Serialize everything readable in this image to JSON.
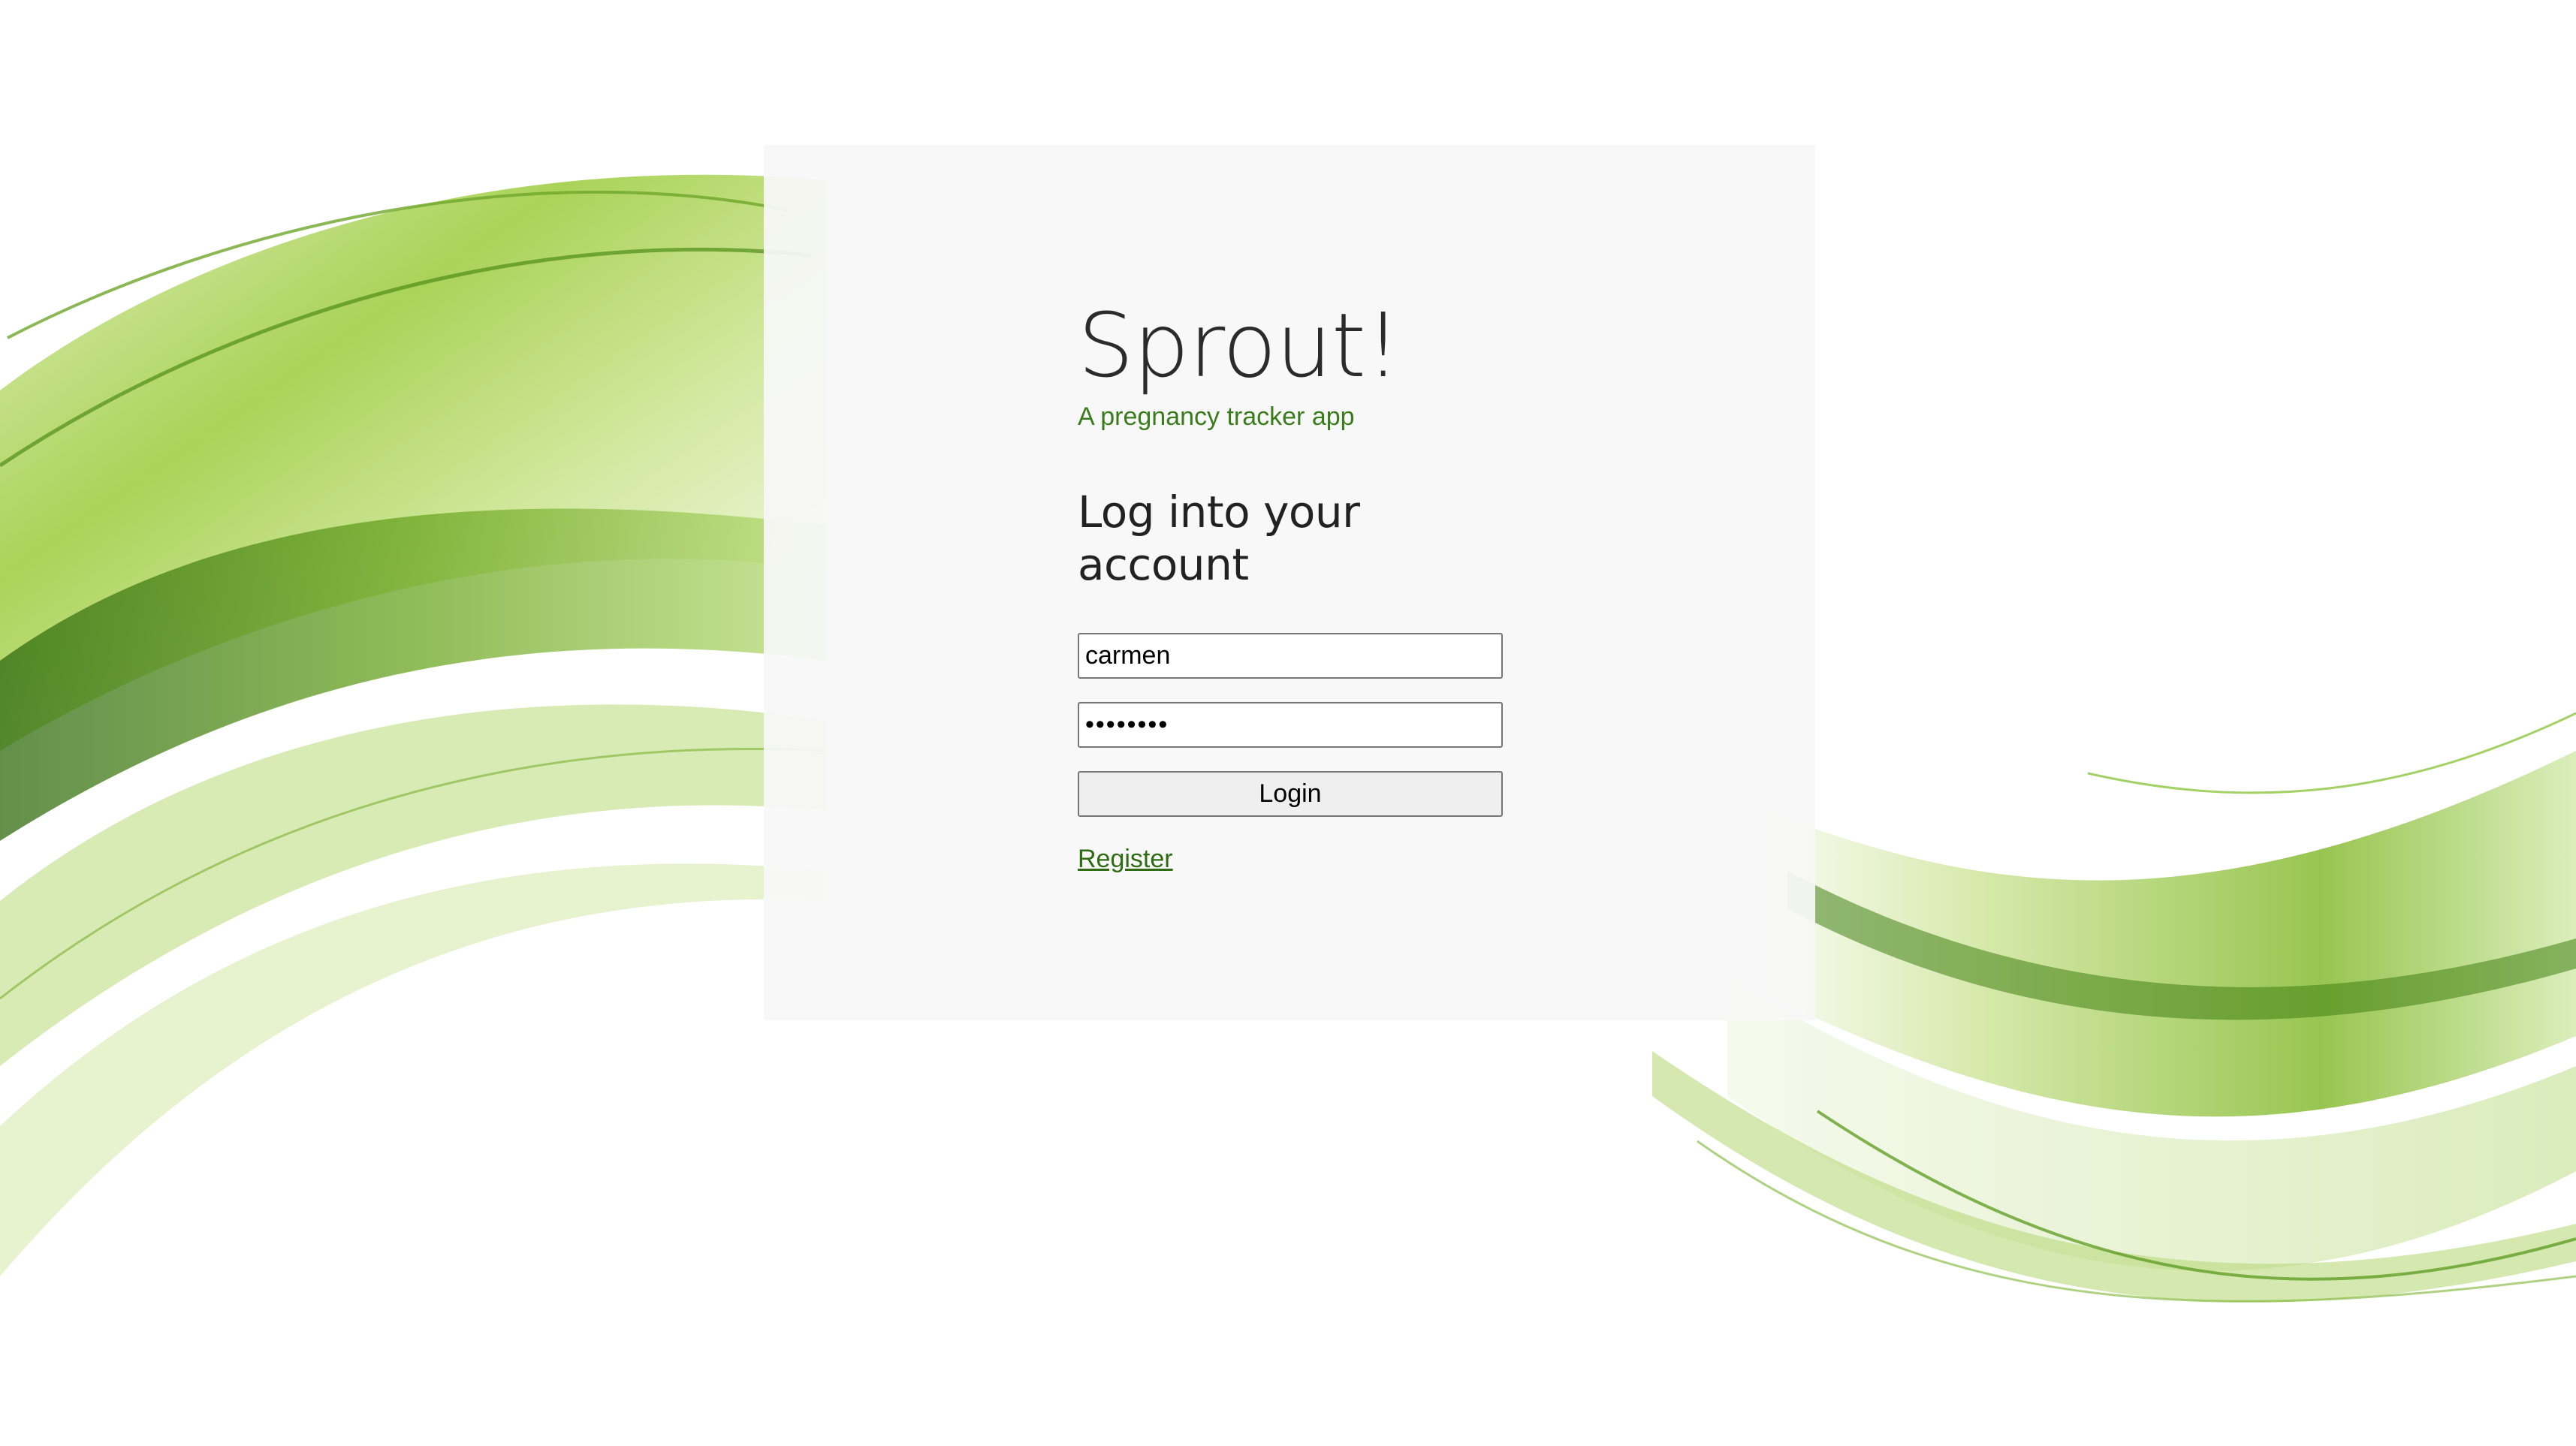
{
  "app": {
    "title": "Sprout!",
    "tagline": "A pregnancy tracker app"
  },
  "login_form": {
    "heading": "Log into your account",
    "username_value": "carmen",
    "password_value": "••••••••",
    "login_label": "Login",
    "register_label": "Register"
  },
  "colors": {
    "accent_green": "#3a7b1c",
    "link_green": "#2e6b12",
    "card_background": "#f7f7f7",
    "wave_green": "#8cc63f"
  }
}
